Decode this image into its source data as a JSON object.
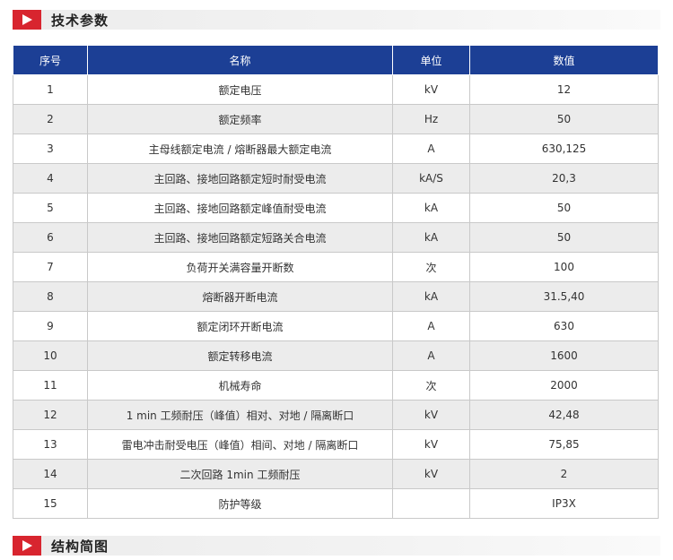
{
  "sections": {
    "top_title": "技术参数",
    "bottom_title": "结构简图"
  },
  "table": {
    "headers": [
      "序号",
      "名称",
      "单位",
      "数值"
    ],
    "rows": [
      [
        "1",
        "额定电压",
        "kV",
        "12"
      ],
      [
        "2",
        "额定频率",
        "Hz",
        "50"
      ],
      [
        "3",
        "主母线额定电流 / 熔断器最大额定电流",
        "A",
        "630,125"
      ],
      [
        "4",
        "主回路、接地回路额定短时耐受电流",
        "kA/S",
        "20,3"
      ],
      [
        "5",
        "主回路、接地回路额定峰值耐受电流",
        "kA",
        "50"
      ],
      [
        "6",
        "主回路、接地回路额定短路关合电流",
        "kA",
        "50"
      ],
      [
        "7",
        "负荷开关满容量开断数",
        "次",
        "100"
      ],
      [
        "8",
        "熔断器开断电流",
        "kA",
        "31.5,40"
      ],
      [
        "9",
        "额定闭环开断电流",
        "A",
        "630"
      ],
      [
        "10",
        "额定转移电流",
        "A",
        "1600"
      ],
      [
        "11",
        "机械寿命",
        "次",
        "2000"
      ],
      [
        "12",
        "1 min 工频耐压（峰值）相对、对地 / 隔离断口",
        "kV",
        "42,48"
      ],
      [
        "13",
        "雷电冲击耐受电压（峰值）相间、对地 / 隔离断口",
        "kV",
        "75,85"
      ],
      [
        "14",
        "二次回路 1min 工频耐压",
        "kV",
        "2"
      ],
      [
        "15",
        "防护等级",
        "",
        "IP3X"
      ]
    ]
  },
  "colors": {
    "header_bg": "#1c3f95",
    "accent_red": "#d8252f",
    "row_alt_bg": "#ececec"
  },
  "icons": {
    "section_marker": "play-triangle-icon"
  }
}
